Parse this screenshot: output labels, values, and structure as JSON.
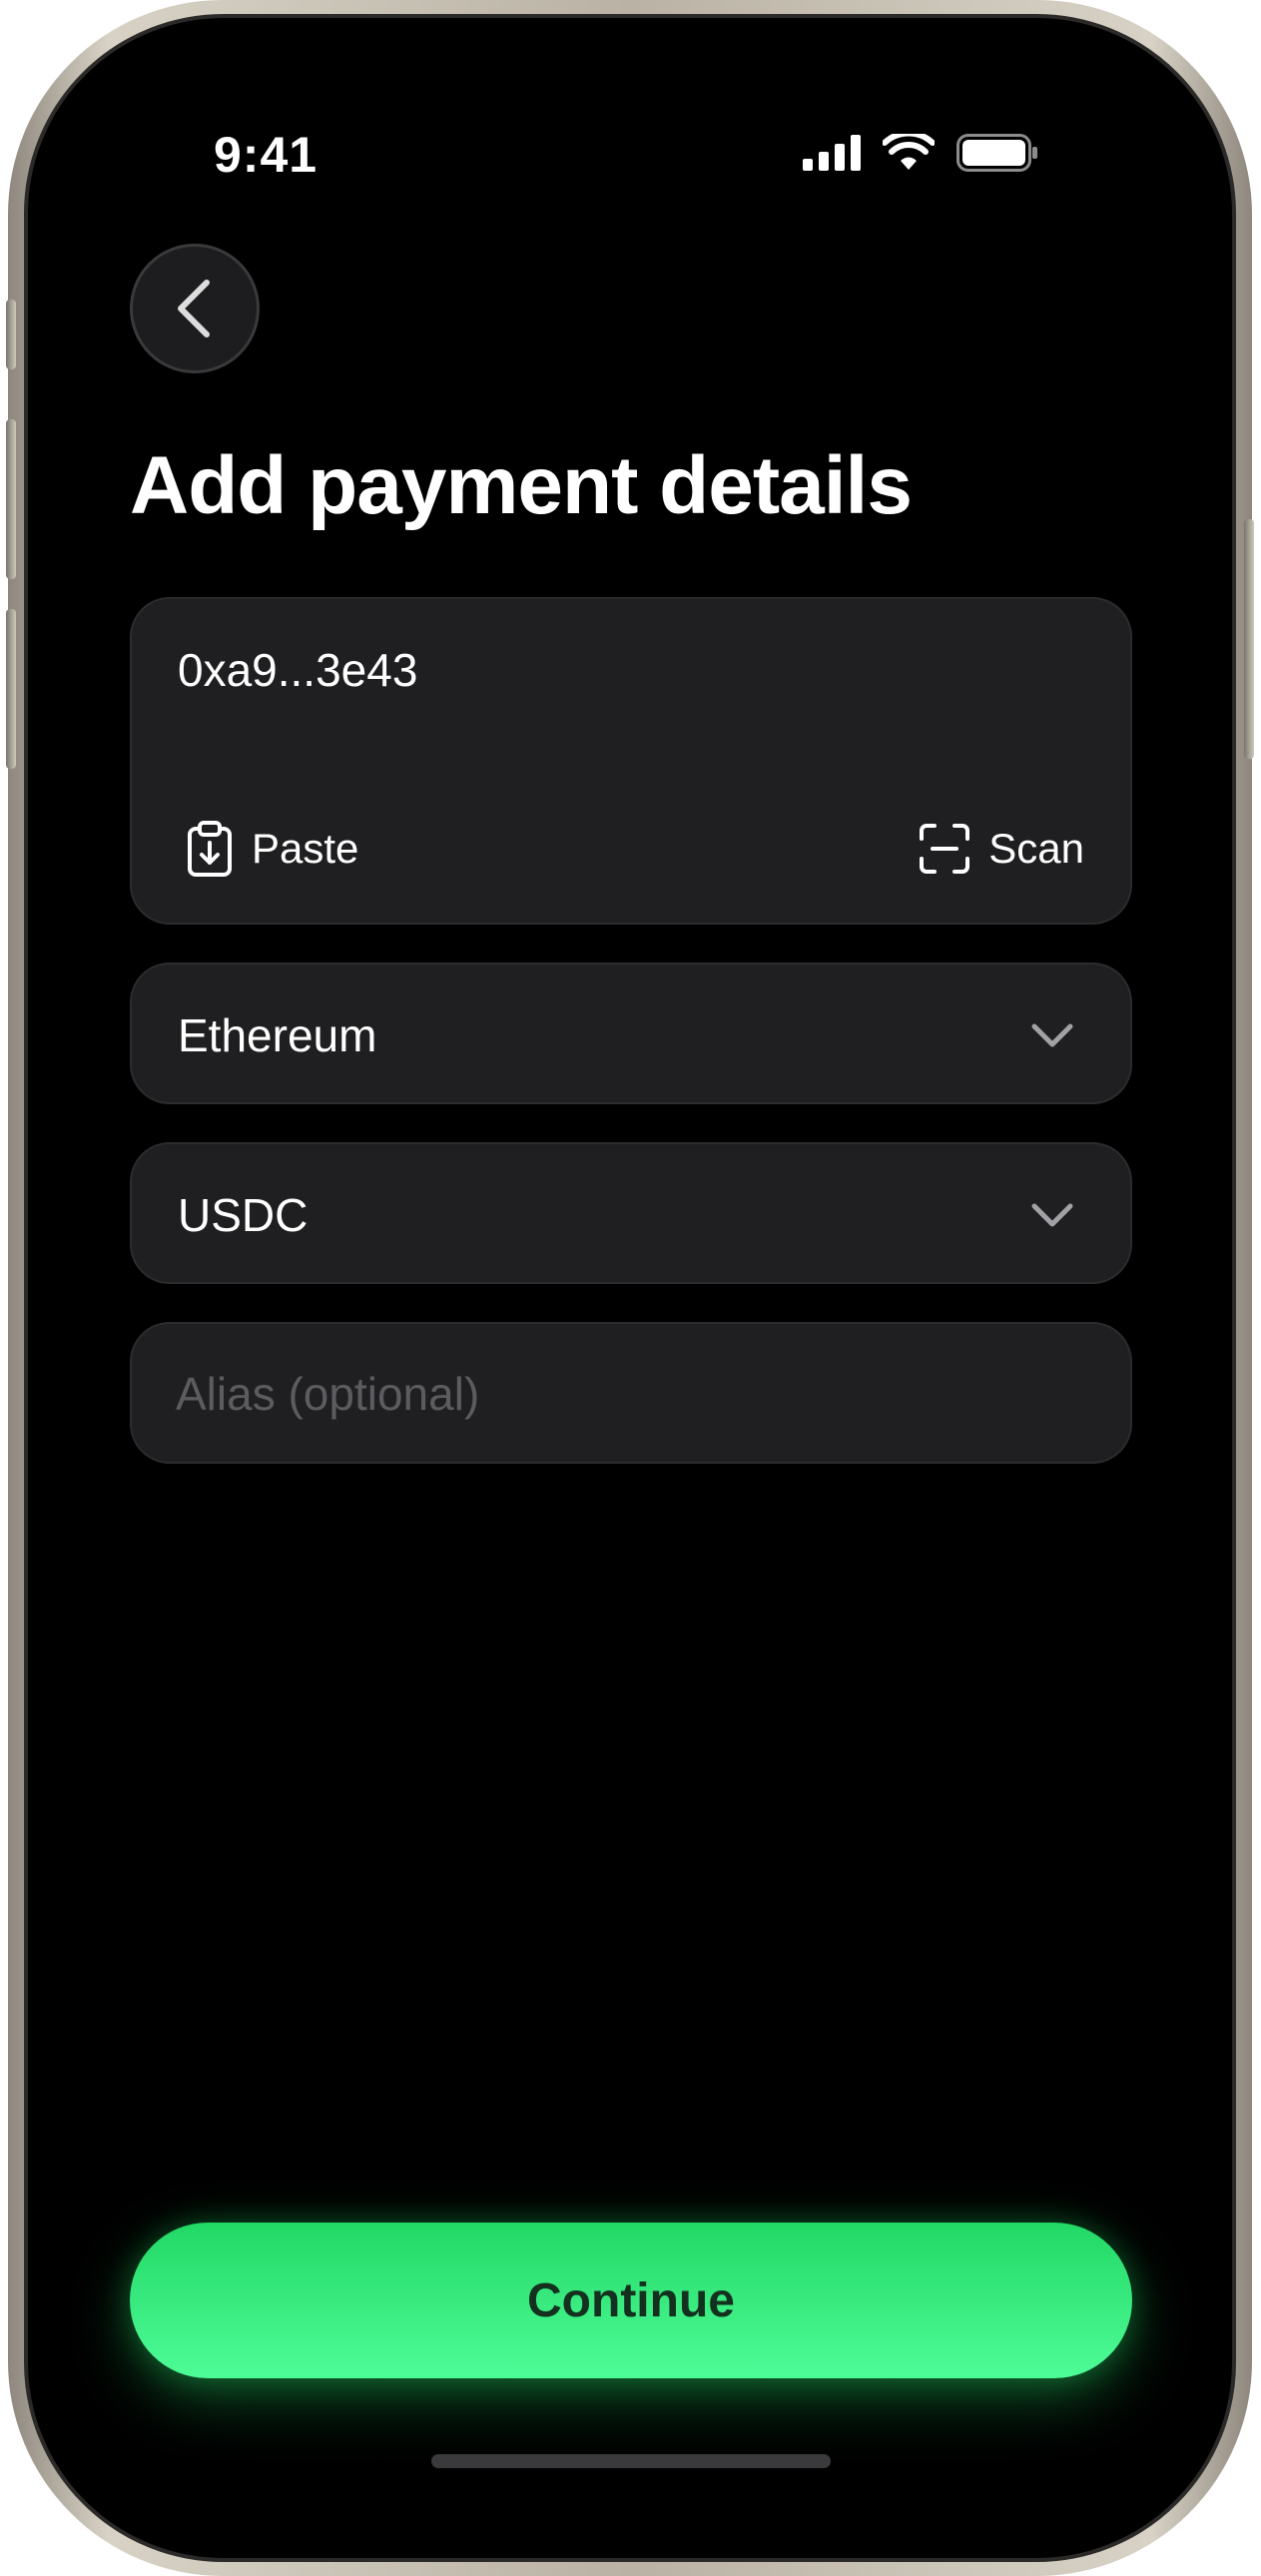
{
  "status_bar": {
    "time": "9:41",
    "icons": [
      "signal-icon",
      "wifi-icon",
      "battery-icon"
    ]
  },
  "header": {
    "back_icon": "chevron-left-icon",
    "title": "Add payment details"
  },
  "address": {
    "value": "0xa9...3e43",
    "paste_label": "Paste",
    "paste_icon": "clipboard-download-icon",
    "scan_label": "Scan",
    "scan_icon": "scan-frame-icon"
  },
  "network_select": {
    "value": "Ethereum",
    "icon": "chevron-down-icon"
  },
  "token_select": {
    "value": "USDC",
    "icon": "chevron-down-icon"
  },
  "alias": {
    "value": "",
    "placeholder": "Alias (optional)"
  },
  "continue_button": {
    "label": "Continue"
  },
  "colors": {
    "background": "#000000",
    "card": "#1f1f21",
    "accent": "#2ee878",
    "button_text": "#14301f",
    "placeholder": "#5c5c60"
  }
}
